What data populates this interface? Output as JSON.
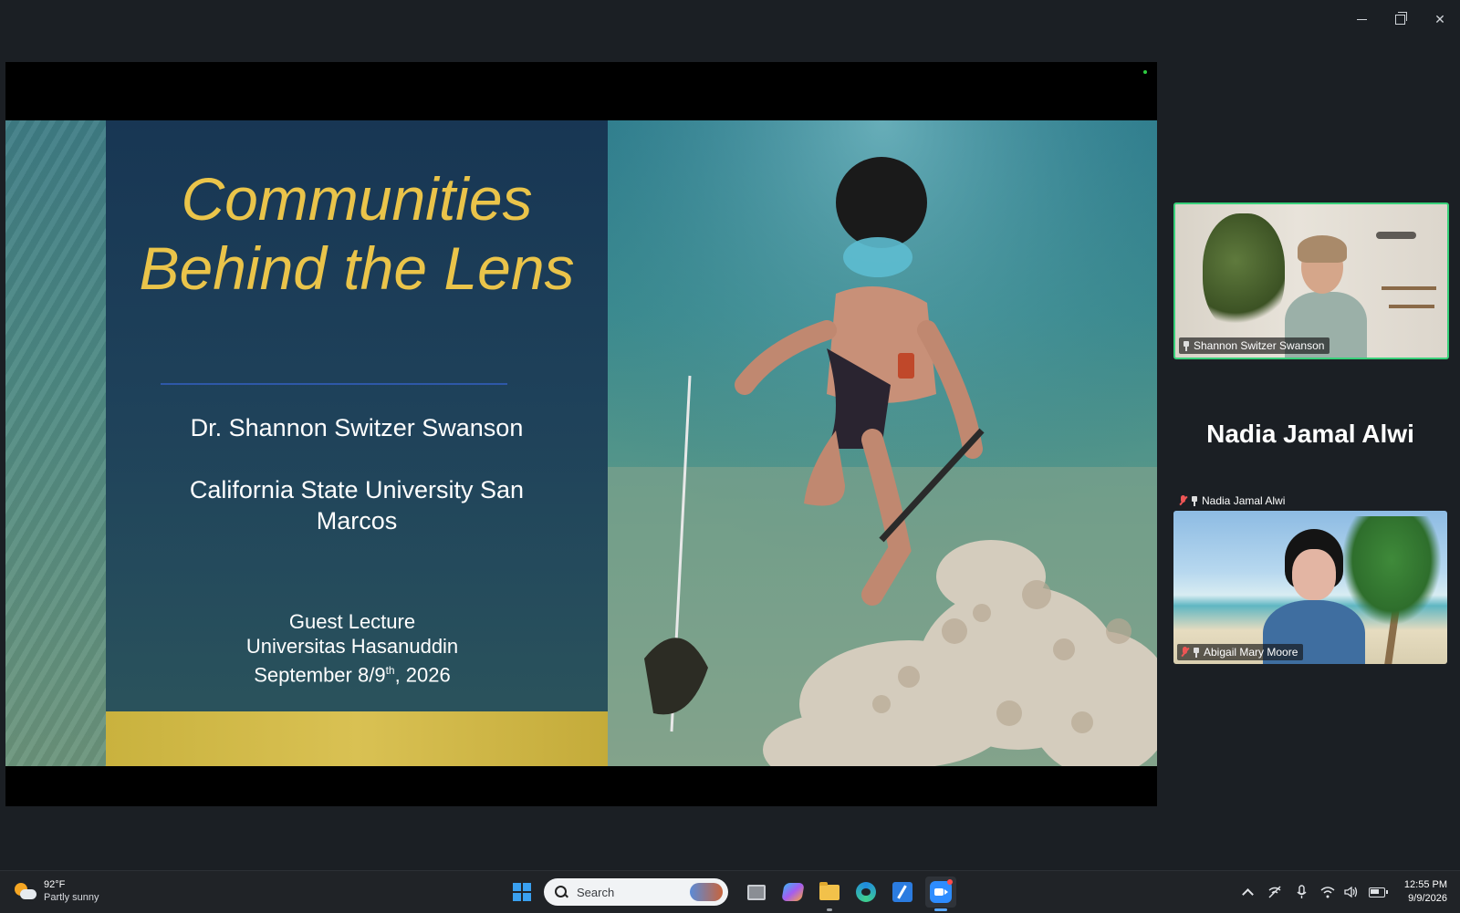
{
  "window": {
    "minimize_icon": "minimize-icon",
    "restore_icon": "restore-icon",
    "close_icon": "close-icon"
  },
  "slide": {
    "title_line1": "Communities",
    "title_line2": "Behind the Lens",
    "presenter": "Dr. Shannon Switzer Swanson",
    "affiliation_line1": "California State University San",
    "affiliation_line2": "Marcos",
    "event": "Guest Lecture",
    "host": "Universitas Hasanuddin",
    "date_prefix": "September 8/9",
    "date_sup": "th",
    "date_suffix": ", 2026",
    "title_color": "#eac44a",
    "accent_color": "#d9c153"
  },
  "participants": {
    "speaker_tile_name": "Shannon Switzer Swanson",
    "active_speaker_border": "#38d07a",
    "featured_name": "Nadia Jamal Alwi",
    "nadia_label": "Nadia Jamal Alwi",
    "second_tile_name": "Abigail Mary Moore"
  },
  "taskbar": {
    "temperature": "92°F",
    "condition": "Partly sunny",
    "search_placeholder": "Search",
    "time": "12:55 PM",
    "date": "9/9/2026"
  }
}
